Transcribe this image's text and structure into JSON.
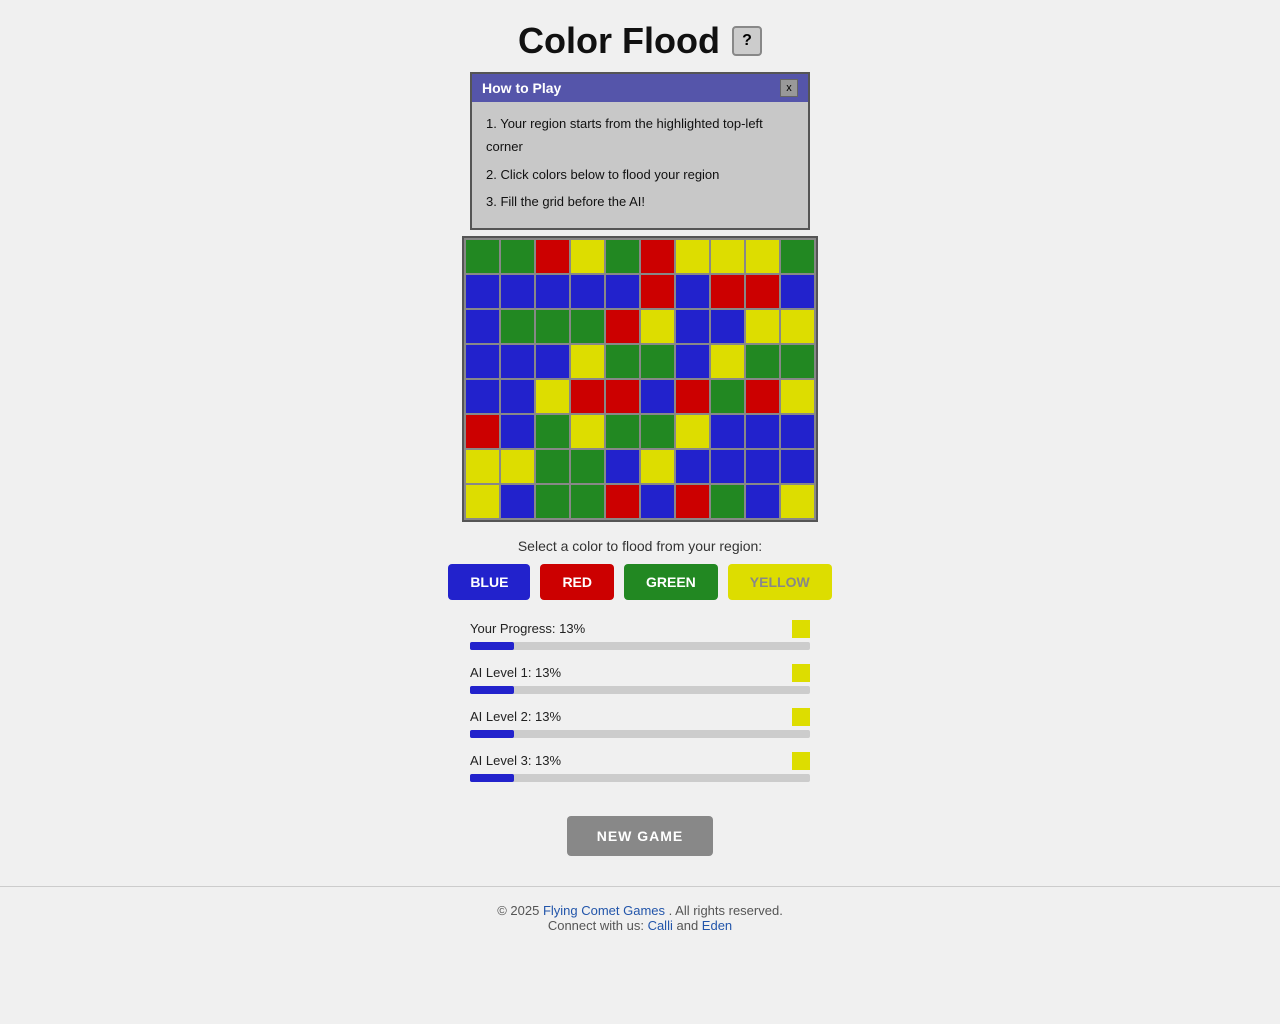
{
  "app": {
    "title": "Color Flood",
    "help_button_label": "?"
  },
  "how_to_play": {
    "title": "How to Play",
    "close_label": "x",
    "instructions": [
      "1. Your region starts from the highlighted top-left corner",
      "2. Click colors below to flood your region",
      "3. Fill the grid before the AI!"
    ]
  },
  "grid": {
    "rows": 8,
    "cols": 10,
    "cells": [
      [
        "green",
        "green",
        "red",
        "yellow",
        "green",
        "red",
        "yellow",
        "yellow",
        "yellow",
        "green"
      ],
      [
        "blue",
        "blue",
        "blue",
        "blue",
        "blue",
        "red",
        "blue",
        "red",
        "red",
        "blue"
      ],
      [
        "blue",
        "green",
        "green",
        "green",
        "red",
        "yellow",
        "blue",
        "blue",
        "yellow",
        "yellow"
      ],
      [
        "blue",
        "blue",
        "blue",
        "yellow",
        "green",
        "green",
        "blue",
        "yellow",
        "green",
        "green"
      ],
      [
        "blue",
        "blue",
        "yellow",
        "red",
        "red",
        "blue",
        "red",
        "green",
        "red",
        "yellow"
      ],
      [
        "red",
        "blue",
        "green",
        "yellow",
        "green",
        "green",
        "yellow",
        "blue",
        "blue",
        "blue"
      ],
      [
        "yellow",
        "yellow",
        "green",
        "green",
        "blue",
        "yellow",
        "blue",
        "blue",
        "blue",
        "blue"
      ],
      [
        "yellow",
        "blue",
        "green",
        "green",
        "red",
        "blue",
        "red",
        "green",
        "blue",
        "yellow"
      ]
    ]
  },
  "select_label": "Select a color to flood from your region:",
  "color_buttons": [
    {
      "label": "BLUE",
      "color": "blue",
      "active": true
    },
    {
      "label": "RED",
      "color": "red",
      "active": true
    },
    {
      "label": "GREEN",
      "color": "green",
      "active": true
    },
    {
      "label": "YELLOW",
      "color": "yellow",
      "active": false
    }
  ],
  "progress": [
    {
      "label": "Your Progress: 13%",
      "pct": 13,
      "color": "#dddd00"
    },
    {
      "label": "AI Level 1: 13%",
      "pct": 13,
      "color": "#dddd00"
    },
    {
      "label": "AI Level 2: 13%",
      "pct": 13,
      "color": "#dddd00"
    },
    {
      "label": "AI Level 3: 13%",
      "pct": 13,
      "color": "#dddd00"
    }
  ],
  "new_game_label": "NEW GAME",
  "footer": {
    "copyright": "© 2025",
    "company_name": "Flying Comet Games",
    "company_url": "#",
    "rights": ". All rights reserved.",
    "connect_text": "Connect with us:",
    "calli_label": "Calli",
    "calli_url": "#",
    "and_text": "and",
    "eden_label": "Eden",
    "eden_url": "#"
  }
}
